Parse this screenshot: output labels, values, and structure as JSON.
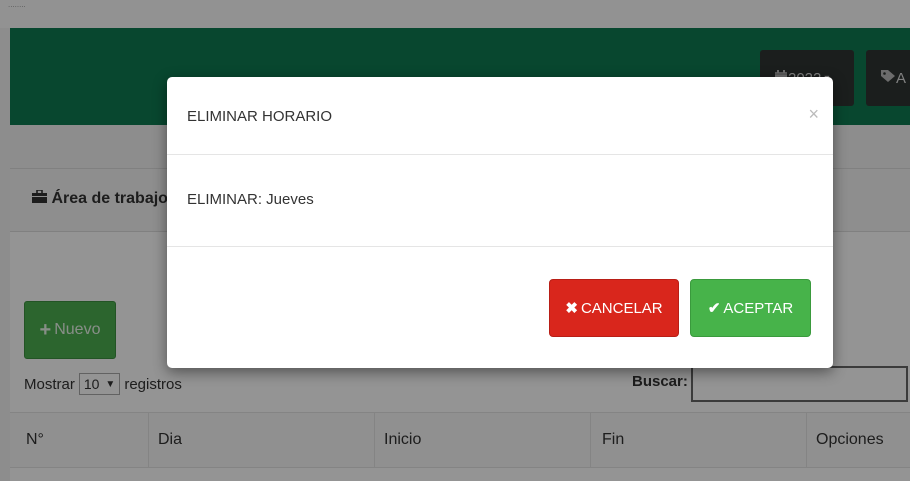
{
  "topbar": {
    "small_text": "........"
  },
  "navbar": {
    "year_button": {
      "icon": "calendar-icon",
      "label": "2022"
    },
    "tag_button": {
      "icon": "tag-icon",
      "label": "A"
    }
  },
  "panel": {
    "icon": "briefcase-icon",
    "title": "Área de trabajo"
  },
  "actions": {
    "new_label": "Nuevo"
  },
  "table_controls": {
    "show_label": "Mostrar",
    "page_size": "10",
    "records_label": "registros",
    "search_label": "Buscar:",
    "search_value": ""
  },
  "table": {
    "headers": [
      "N°",
      "Dia",
      "Inicio",
      "Fin",
      "Opciones"
    ]
  },
  "modal": {
    "title": "ELIMINAR HORARIO",
    "close_symbol": "×",
    "message": "ELIMINAR: Jueves",
    "cancel_label": "CANCELAR",
    "accept_label": "ACEPTAR"
  },
  "colors": {
    "navbar": "#0f7a52",
    "danger": "#d9261c",
    "success": "#47b34a"
  }
}
